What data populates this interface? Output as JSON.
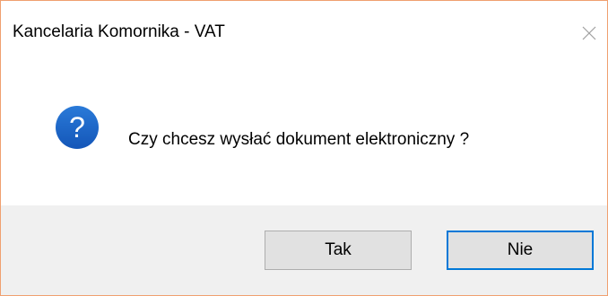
{
  "dialog": {
    "title": "Kancelaria Komornika - VAT",
    "message": "Czy chcesz wysłać dokument elektroniczny ?",
    "icon": "question-icon",
    "buttons": {
      "yes_label": "Tak",
      "no_label": "Nie",
      "default": "no"
    }
  },
  "colors": {
    "window_border": "#f0a070",
    "icon_fill": "#1c64c4",
    "footer_bg": "#f0f0f0",
    "button_bg": "#e1e1e1",
    "focus_border": "#0078d7"
  }
}
